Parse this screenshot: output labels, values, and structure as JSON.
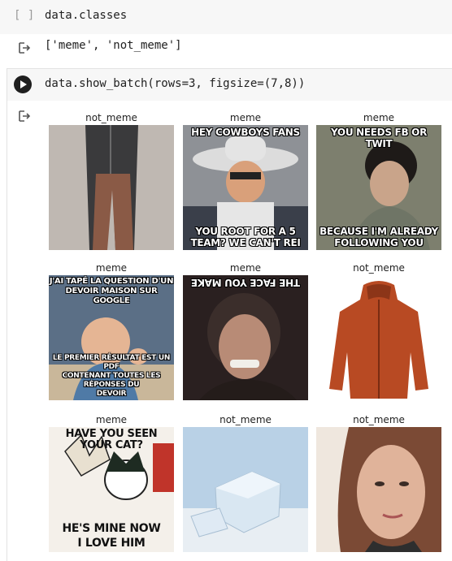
{
  "cell1": {
    "exec_count": "[ ]",
    "code": "data.classes",
    "output": "['meme', 'not_meme']"
  },
  "cell2": {
    "code": "data.show_batch(rows=3, figsize=(7,8))"
  },
  "batch": [
    {
      "label": "not_meme",
      "top": "",
      "bottom": ""
    },
    {
      "label": "meme",
      "top": "HEY COWBOYS FANS",
      "bottom": "YOU ROOT FOR A 5\nTEAM? WE CAN'T REI"
    },
    {
      "label": "meme",
      "top": "YOU NEEDS FB OR TWIT",
      "bottom": "BECAUSE I'M ALREADY\nFOLLOWING YOU"
    },
    {
      "label": "meme",
      "top": "J'AI TAPÉ LA QUESTION D'UN\nDEVOIR MAISON SUR GOOGLE",
      "bottom": "LE PREMIER RÉSULTAT EST UN PDF\nCONTENANT TOUTES LES RÉPONSES DU\nDEVOIR"
    },
    {
      "label": "meme",
      "top": "THE FACE YOU MAKE",
      "bottom": ""
    },
    {
      "label": "not_meme",
      "top": "",
      "bottom": ""
    },
    {
      "label": "meme",
      "top": "HAVE YOU SEEN\nYOUR CAT?",
      "bottom": "HE'S MINE NOW\nI LOVE HIM"
    },
    {
      "label": "not_meme",
      "top": "",
      "bottom": ""
    },
    {
      "label": "not_meme",
      "top": "",
      "bottom": ""
    }
  ],
  "colors": {
    "cell_bg": "#f7f7f7",
    "run_button": "#1f1f1f",
    "text": "#212121"
  },
  "icons": {
    "run": "play-circle-icon",
    "output": "output-arrow-icon"
  }
}
